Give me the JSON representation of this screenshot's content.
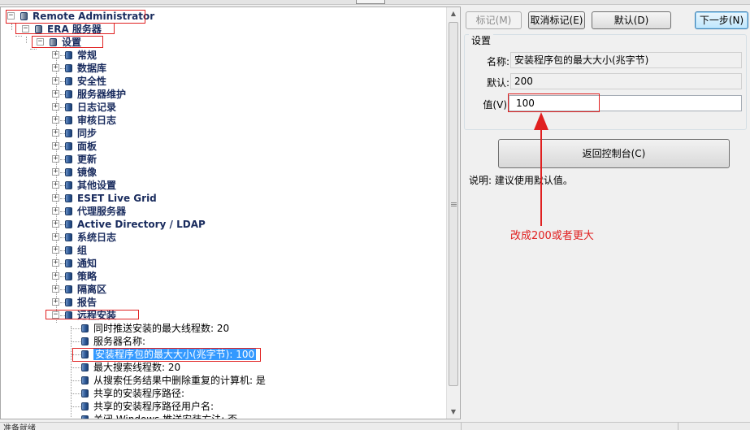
{
  "tree": {
    "root": "Remote Administrator",
    "server": "ERA 服务器",
    "settings": "设置",
    "categories": [
      "常规",
      "数据库",
      "安全性",
      "服务器维护",
      "日志记录",
      "审核日志",
      "同步",
      "面板",
      "更新",
      "镜像",
      "其他设置",
      "ESET Live Grid",
      "代理服务器",
      "Active Directory / LDAP",
      "系统日志",
      "组",
      "通知",
      "策略",
      "隔离区",
      "报告"
    ],
    "remote_install": "远程安装",
    "children": [
      "同时推送安装的最大线程数: 20",
      "服务器名称:",
      "安装程序包的最大大小(兆字节): 100",
      "最大搜索线程数: 20",
      "从搜索任务结果中删除重复的计算机: 是",
      "共享的安装程序路径:",
      "共享的安装程序路径用户名:",
      "关闭 Windows 推送安装方法: 否"
    ]
  },
  "toolbar": {
    "mark": "标记(M)",
    "unmark": "取消标记(E)",
    "default": "默认(D)",
    "next": "下一步(N)"
  },
  "panel": {
    "group_title": "设置",
    "name_label": "名称:",
    "name_value": "安装程序包的最大大小(兆字节)",
    "default_label": "默认:",
    "default_value": "200",
    "value_label": "值(V)",
    "value": "100",
    "return_button": "返回控制台(C)",
    "note": "说明: 建议使用默认值。"
  },
  "annotation": "改成200或者更大",
  "statusbar": {
    "left": "准备就绪"
  },
  "colors": {
    "annotation_red": "#e02020",
    "selection_blue": "#3399ff",
    "node_text": "#1a2c5e"
  }
}
